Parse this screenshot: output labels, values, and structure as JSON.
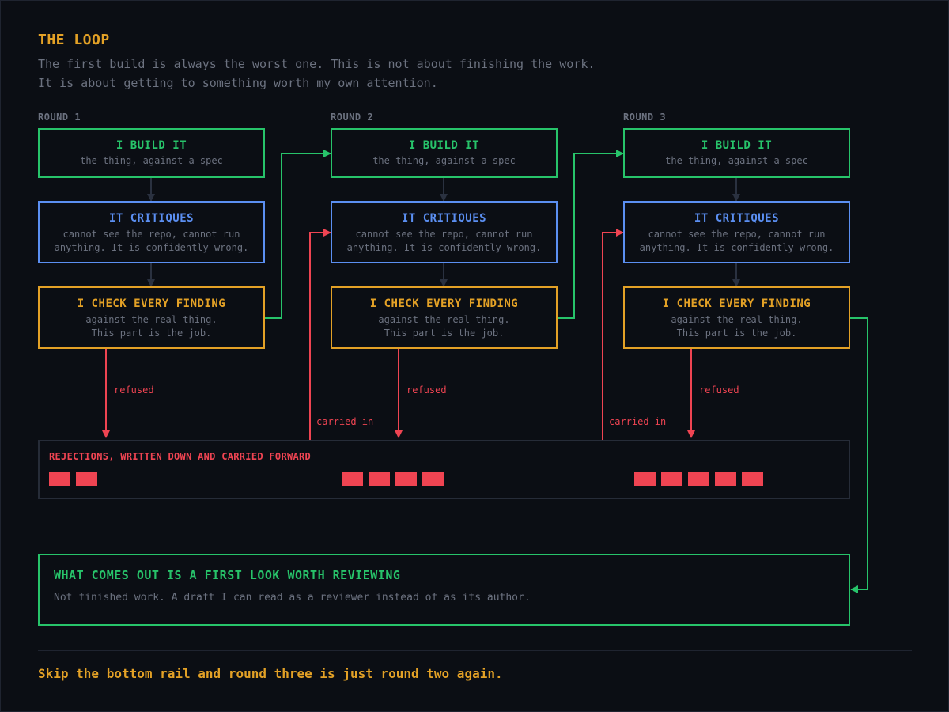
{
  "title": "THE LOOP",
  "subtitle": [
    "The first build is always the worst one. This is not about finishing the work.",
    "It is about getting to something worth my own attention."
  ],
  "rounds": [
    {
      "label": "ROUND 1",
      "build": {
        "title": "I BUILD IT",
        "desc": "the thing, against a spec"
      },
      "critique": {
        "title": "IT CRITIQUES",
        "desc": [
          "cannot see the repo, cannot run",
          "anything. It is confidently wrong."
        ]
      },
      "check": {
        "title": "I CHECK EVERY FINDING",
        "desc": [
          "against the real thing.",
          "This part is the job."
        ]
      },
      "refused_label": "refused",
      "rejections": 2
    },
    {
      "label": "ROUND 2",
      "build": {
        "title": "I BUILD IT",
        "desc": "the thing, against a spec"
      },
      "critique": {
        "title": "IT CRITIQUES",
        "desc": [
          "cannot see the repo, cannot run",
          "anything. It is confidently wrong."
        ]
      },
      "check": {
        "title": "I CHECK EVERY FINDING",
        "desc": [
          "against the real thing.",
          "This part is the job."
        ]
      },
      "refused_label": "refused",
      "carried_label": "carried in",
      "rejections": 4
    },
    {
      "label": "ROUND 3",
      "build": {
        "title": "I BUILD IT",
        "desc": "the thing, against a spec"
      },
      "critique": {
        "title": "IT CRITIQUES",
        "desc": [
          "cannot see the repo, cannot run",
          "anything. It is confidently wrong."
        ]
      },
      "check": {
        "title": "I CHECK EVERY FINDING",
        "desc": [
          "against the real thing.",
          "This part is the job."
        ]
      },
      "refused_label": "refused",
      "carried_label": "carried in",
      "rejections": 5
    }
  ],
  "rail_title": "REJECTIONS, WRITTEN DOWN AND CARRIED FORWARD",
  "output": {
    "title": "WHAT COMES OUT IS A FIRST LOOK WORTH REVIEWING",
    "desc": "Not finished work. A draft I can read as a reviewer instead of as its author."
  },
  "footer": "Skip the bottom rail and round three is just round two again.",
  "colors": {
    "build": "#27c36a",
    "critique": "#5b8ff2",
    "check": "#e3a126",
    "rejection": "#ef4452"
  }
}
